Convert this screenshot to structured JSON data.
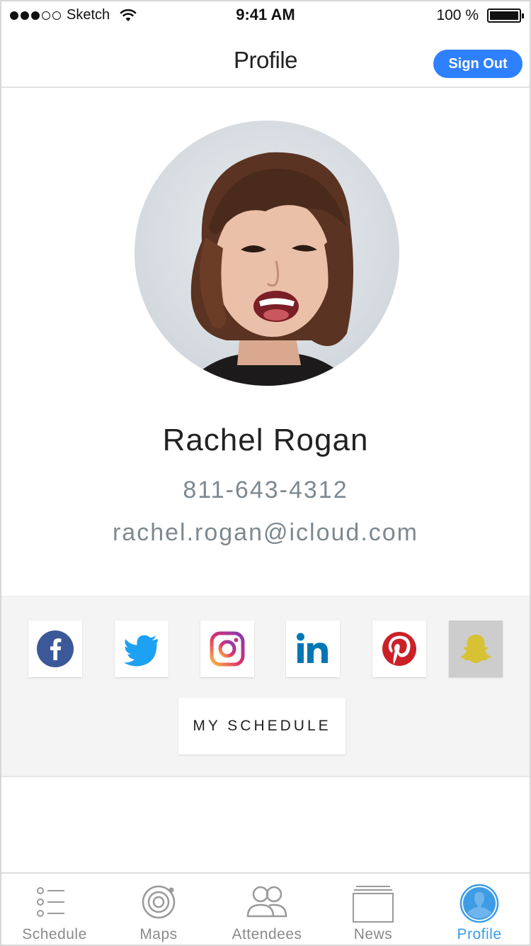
{
  "status_bar": {
    "carrier": "Sketch",
    "time": "9:41 AM",
    "battery": "100 %"
  },
  "nav": {
    "title": "Profile",
    "sign_out_label": "Sign Out"
  },
  "profile": {
    "name": "Rachel Rogan",
    "phone": "811-643-4312",
    "email": "rachel.rogan@icloud.com"
  },
  "social": {
    "items": [
      {
        "name": "facebook",
        "icon": "facebook-icon",
        "color": "#3b5998"
      },
      {
        "name": "twitter",
        "icon": "twitter-icon",
        "color": "#1da1f2"
      },
      {
        "name": "instagram",
        "icon": "instagram-icon",
        "color": "#d6249f"
      },
      {
        "name": "linkedin",
        "icon": "linkedin-icon",
        "color": "#0077b5"
      },
      {
        "name": "pinterest",
        "icon": "pinterest-icon",
        "color": "#cb2027"
      },
      {
        "name": "snapchat",
        "icon": "snapchat-icon",
        "color": "#e2cc2f"
      }
    ],
    "schedule_label": "MY SCHEDULE"
  },
  "tabs": [
    {
      "label": "Schedule",
      "icon": "list-icon",
      "active": false
    },
    {
      "label": "Maps",
      "icon": "target-icon",
      "active": false
    },
    {
      "label": "Attendees",
      "icon": "people-icon",
      "active": false
    },
    {
      "label": "News",
      "icon": "newspaper-icon",
      "active": false
    },
    {
      "label": "Profile",
      "icon": "person-icon",
      "active": true
    }
  ],
  "colors": {
    "accent": "#2f80ff",
    "tab_active": "#3e9ce6",
    "tab_inactive": "#8a8a8a",
    "secondary_text": "#7d8990"
  }
}
